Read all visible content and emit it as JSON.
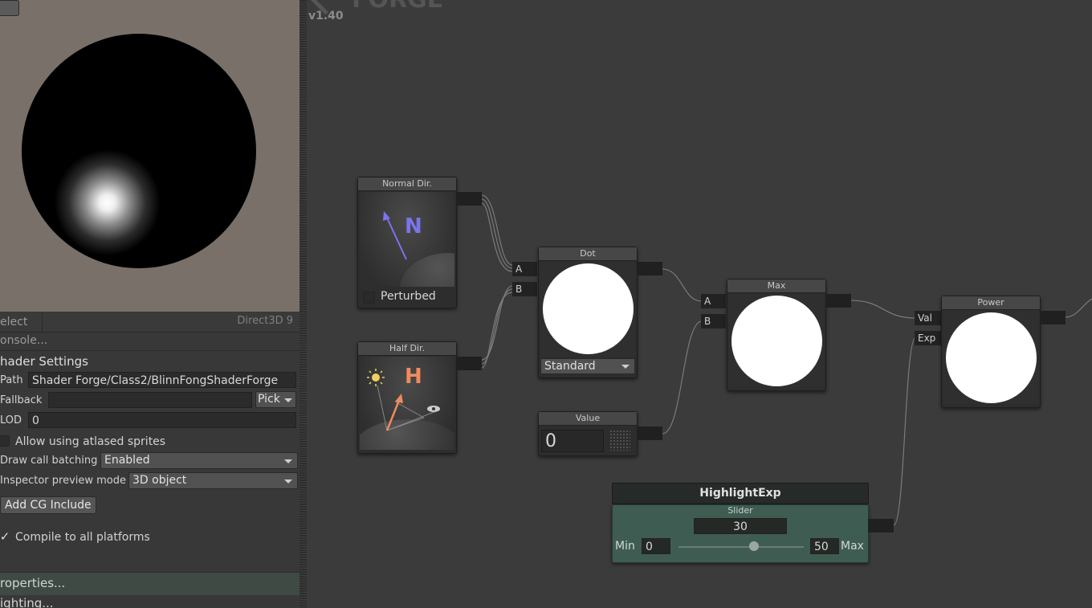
{
  "canvas": {
    "version": "v1.40",
    "logo_text": "FORGE"
  },
  "left_panel": {
    "tabs": {
      "select_label": "elect",
      "renderer_label": "Direct3D 9"
    },
    "console_label": "onsole...",
    "shader_settings": {
      "heading": "hader Settings",
      "path_label": "Path",
      "path_value": "Shader Forge/Class2/BlinnFongShaderForge",
      "fallback_label": "Fallback",
      "fallback_value": "",
      "pick_label": "Pick",
      "lod_label": "LOD",
      "lod_value": "0",
      "allow_atlased_label": "Allow using atlased sprites",
      "allow_atlased_checked": false,
      "draw_call_label": "Draw call batching",
      "draw_call_value": "Enabled",
      "inspector_preview_label": "Inspector preview mode",
      "inspector_preview_value": "3D object",
      "add_cg_include_label": "Add CG Include",
      "compile_all_label": "Compile to all platforms",
      "compile_all_checked": true
    },
    "properties_label": "roperties...",
    "lighting_label": "ighting..."
  },
  "nodes": {
    "normal_dir": {
      "title": "Normal Dir.",
      "glyph": "N",
      "perturbed_label": "Perturbed",
      "perturbed_checked": false
    },
    "half_dir": {
      "title": "Half Dir.",
      "glyph": "H"
    },
    "dot": {
      "title": "Dot",
      "input_a": "A",
      "input_b": "B",
      "mode_value": "Standard"
    },
    "value": {
      "title": "Value",
      "value": "0"
    },
    "max": {
      "title": "Max",
      "input_a": "A",
      "input_b": "B"
    },
    "power": {
      "title": "Power",
      "input_val": "Val",
      "input_exp": "Exp"
    },
    "highlight_exp": {
      "name": "HighlightExp",
      "type_label": "Slider",
      "current_value": "30",
      "min_label": "Min",
      "min_value": "0",
      "max_label": "Max",
      "max_value": "50",
      "slider_fraction": 0.6
    }
  },
  "colors": {
    "normal_arrow": "#7b74ee",
    "half_glyph": "#f08a5d",
    "slider_node_bg": "#3f5c53",
    "preview_bg": "#797069"
  }
}
